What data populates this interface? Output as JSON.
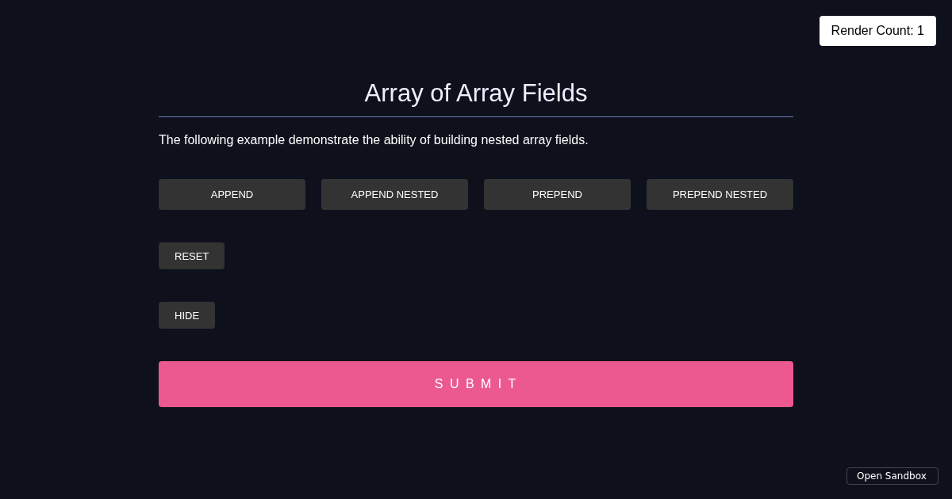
{
  "render_count": "Render Count: 1",
  "title": "Array of Array Fields",
  "description": "The following example demonstrate the ability of building nested array fields.",
  "action_buttons": [
    "APPEND",
    "APPEND NESTED",
    "PREPEND",
    "PREPEND NESTED"
  ],
  "reset_button": "RESET",
  "hide_button": "HIDE",
  "submit_button": "S U B M I T",
  "sandbox_link": "Open Sandbox"
}
